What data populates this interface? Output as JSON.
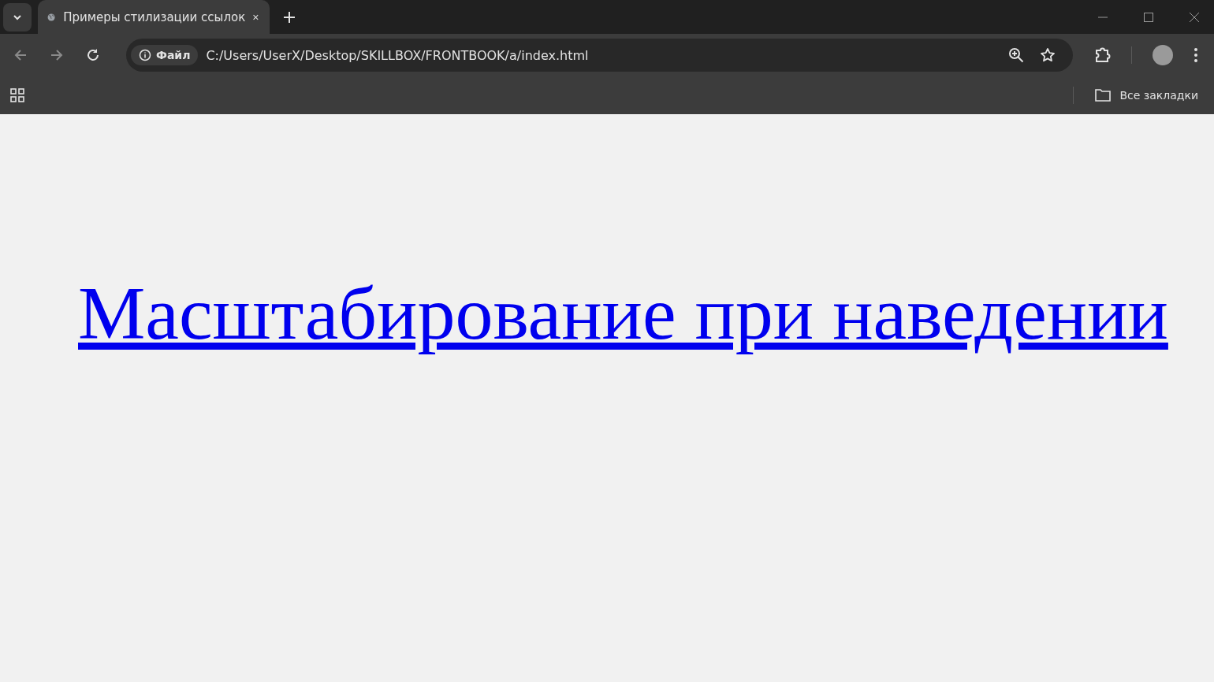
{
  "tabs": [
    {
      "title": "Примеры стилизации ссылок",
      "selected": true
    }
  ],
  "address_bar": {
    "security_chip": "Файл",
    "url": "C:/Users/UserX/Desktop/SKILLBOX/FRONTBOOK/a/index.html"
  },
  "bookmarks_bar": {
    "all_bookmarks": "Все закладки"
  },
  "page": {
    "link": "Масштабирование при наведении"
  }
}
